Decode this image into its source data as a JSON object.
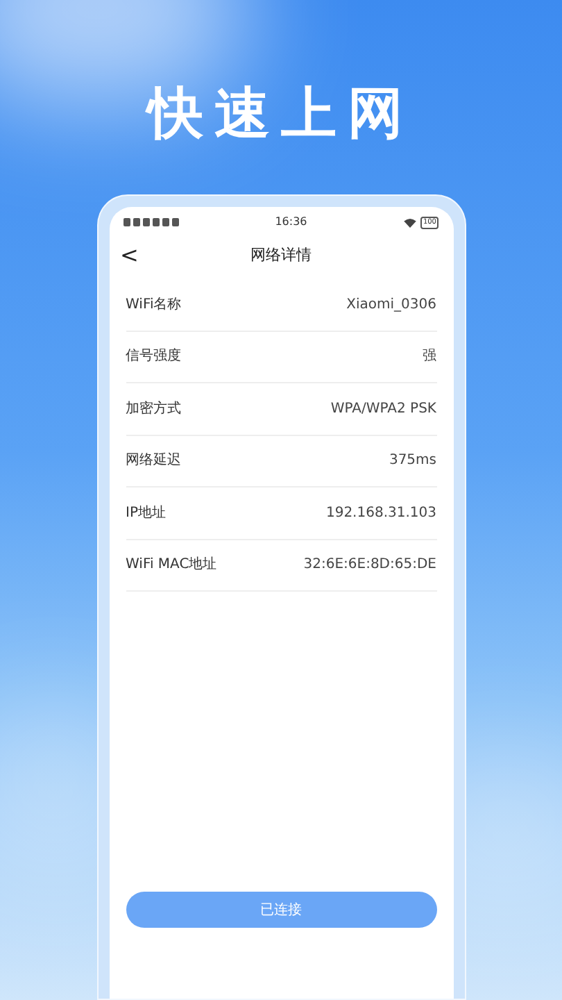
{
  "headline": "快速上网",
  "status_bar": {
    "time": "16:36",
    "battery": "100"
  },
  "nav": {
    "back": "<",
    "title": "网络详情"
  },
  "rows": [
    {
      "label": "WiFi名称",
      "value": "Xiaomi_0306"
    },
    {
      "label": "信号强度",
      "value": "强"
    },
    {
      "label": "加密方式",
      "value": "WPA/WPA2 PSK"
    },
    {
      "label": "网络延迟",
      "value": "375ms"
    },
    {
      "label": "IP地址",
      "value": "192.168.31.103"
    },
    {
      "label": "WiFi MAC地址",
      "value": "32:6E:6E:8D:65:DE"
    }
  ],
  "button": "已连接"
}
